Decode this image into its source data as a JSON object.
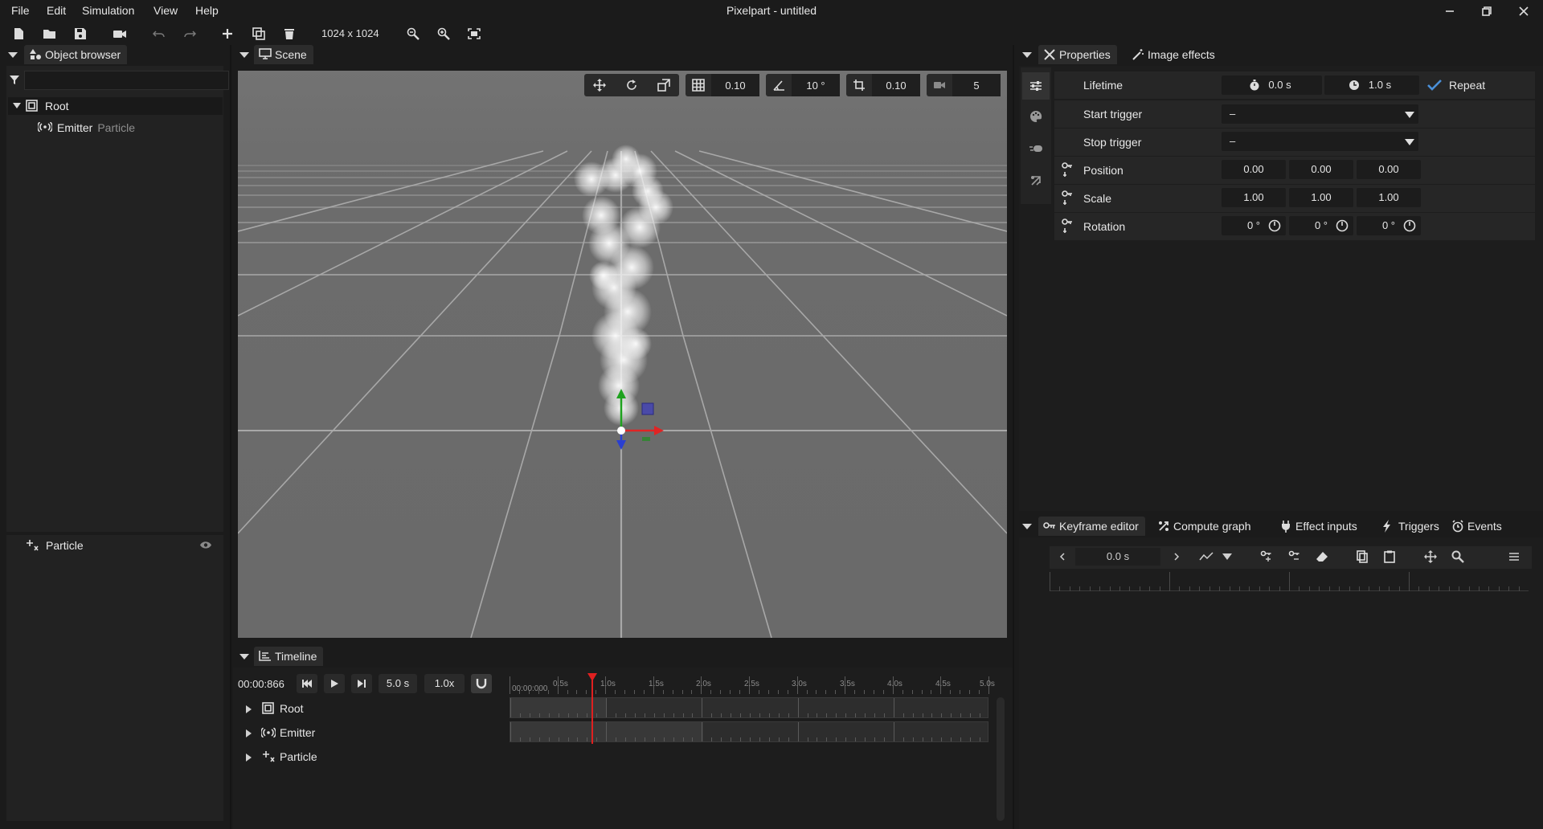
{
  "app": {
    "title": "Pixelpart - untitled"
  },
  "menu": [
    "File",
    "Edit",
    "Simulation",
    "View",
    "Help"
  ],
  "toolbar": {
    "resolution": "1024 x 1024"
  },
  "object_browser": {
    "tab_label": "Object browser",
    "filter_placeholder": "",
    "tree": [
      {
        "label": "Root",
        "sub": ""
      },
      {
        "label": "Emitter",
        "sub": "Particle"
      }
    ],
    "particle_panel": {
      "label": "Particle"
    }
  },
  "scene": {
    "tab_label": "Scene",
    "grid_value": "0.10",
    "angle_value": "10 °",
    "scale_snap_value": "0.10",
    "camera_value": "5"
  },
  "properties": {
    "tabs": [
      "Properties",
      "Image effects"
    ],
    "lifetime": {
      "label": "Lifetime",
      "start": "0.0 s",
      "duration": "1.0 s",
      "repeat_label": "Repeat",
      "repeat_checked": true
    },
    "start_trigger": {
      "label": "Start trigger",
      "value": "–"
    },
    "stop_trigger": {
      "label": "Stop trigger",
      "value": "–"
    },
    "position": {
      "label": "Position",
      "x": "0.00",
      "y": "0.00",
      "z": "0.00"
    },
    "scale": {
      "label": "Scale",
      "x": "1.00",
      "y": "1.00",
      "z": "1.00"
    },
    "rotation": {
      "label": "Rotation",
      "x": "0 °",
      "y": "0 °",
      "z": "0 °"
    }
  },
  "keyframe_panel": {
    "tabs": [
      "Keyframe editor",
      "Compute graph",
      "Effect inputs",
      "Triggers",
      "Events"
    ],
    "time_value": "0.0 s"
  },
  "timeline": {
    "tab_label": "Timeline",
    "current_time": "00:00:866",
    "duration": "5.0 s",
    "speed": "1.0x",
    "ruler_start": "00:00:000",
    "ruler_labels": [
      "0.5s",
      "1.0s",
      "1.5s",
      "2.0s",
      "2.5s",
      "3.0s",
      "3.5s",
      "4.0s",
      "4.5s",
      "5.0s"
    ],
    "rows": [
      "Root",
      "Emitter",
      "Particle"
    ]
  },
  "colors": {
    "accent": "#4a90d9",
    "playhead": "#e02020",
    "axis_x": "#e02424",
    "axis_y": "#1fa21f",
    "axis_z": "#2a3fd0"
  }
}
